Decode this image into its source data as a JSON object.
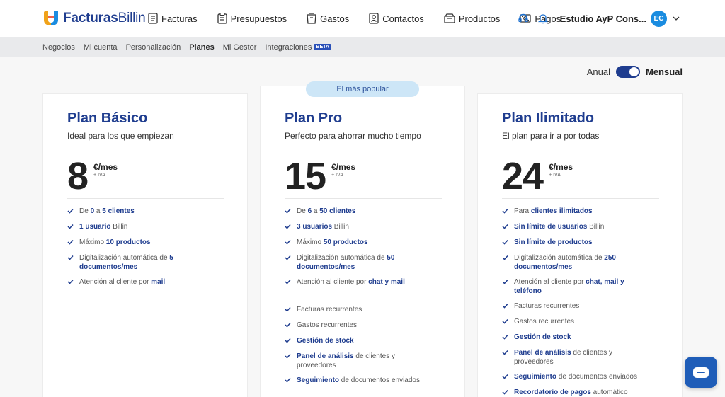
{
  "header": {
    "logo_word1": "Facturas",
    "logo_word2": "Billin",
    "nav": [
      {
        "label": "Facturas",
        "icon": "invoice-icon"
      },
      {
        "label": "Presupuestos",
        "icon": "quote-icon"
      },
      {
        "label": "Gastos",
        "icon": "expenses-icon"
      },
      {
        "label": "Contactos",
        "icon": "contacts-icon"
      },
      {
        "label": "Productos",
        "icon": "products-icon"
      },
      {
        "label": "Pagos",
        "icon": "payments-icon"
      }
    ],
    "account_name": "Estudio AyP Cons...",
    "avatar_initials": "EC"
  },
  "subnav": {
    "items": [
      "Negocios",
      "Mi cuenta",
      "Personalización",
      "Planes",
      "Mi Gestor",
      "Integraciones"
    ],
    "active": "Planes",
    "beta_badge": "BETA"
  },
  "billing_toggle": {
    "left_label": "Anual",
    "right_label": "Mensual",
    "selected": "Mensual"
  },
  "popular_badge": "El más popular",
  "plans": [
    {
      "name": "Plan Básico",
      "description": "Ideal para los que empiezan",
      "price": "8",
      "unit": "€/mes",
      "tax": "+ IVA",
      "features": [
        [
          [
            "De ",
            false
          ],
          [
            "0",
            true
          ],
          [
            " a ",
            false
          ],
          [
            "5 clientes",
            true
          ]
        ],
        [
          [
            "1 usuario",
            true
          ],
          [
            " Billin",
            false
          ]
        ],
        [
          [
            "Máximo ",
            false
          ],
          [
            "10 productos",
            true
          ]
        ],
        [
          [
            "Digitalización automática de ",
            false
          ],
          [
            "5 documentos/mes",
            true
          ]
        ],
        [
          [
            "Atención al cliente por ",
            false
          ],
          [
            "mail",
            true
          ]
        ]
      ],
      "extras": []
    },
    {
      "name": "Plan Pro",
      "description": "Perfecto para ahorrar mucho tiempo",
      "price": "15",
      "unit": "€/mes",
      "tax": "+ IVA",
      "features": [
        [
          [
            "De ",
            false
          ],
          [
            "6",
            true
          ],
          [
            " a ",
            false
          ],
          [
            "50 clientes",
            true
          ]
        ],
        [
          [
            "3 usuarios",
            true
          ],
          [
            " Billin",
            false
          ]
        ],
        [
          [
            "Máximo ",
            false
          ],
          [
            "50 productos",
            true
          ]
        ],
        [
          [
            "Digitalización automática de ",
            false
          ],
          [
            "50 documentos/mes",
            true
          ]
        ],
        [
          [
            "Atención al cliente por ",
            false
          ],
          [
            "chat y mail",
            true
          ]
        ]
      ],
      "extras": [
        [
          [
            "Facturas recurrentes",
            false
          ]
        ],
        [
          [
            "Gastos recurrentes",
            false
          ]
        ],
        [
          [
            "Gestión de stock",
            true
          ]
        ],
        [
          [
            "Panel de análisis",
            true
          ],
          [
            " de clientes y proveedores",
            false
          ]
        ],
        [
          [
            "Seguimiento",
            true
          ],
          [
            " de documentos enviados",
            false
          ]
        ]
      ]
    },
    {
      "name": "Plan Ilimitado",
      "description": "El plan para ir a por todas",
      "price": "24",
      "unit": "€/mes",
      "tax": "+ IVA",
      "features": [
        [
          [
            "Para ",
            false
          ],
          [
            "clientes ilimitados",
            true
          ]
        ],
        [
          [
            "Sin límite de usuarios",
            true
          ],
          [
            " Billin",
            false
          ]
        ],
        [
          [
            "Sin límite de productos",
            true
          ]
        ],
        [
          [
            "Digitalización automática de ",
            false
          ],
          [
            "250 documentos/mes",
            true
          ]
        ],
        [
          [
            "Atención al cliente por ",
            false
          ],
          [
            "chat, mail y teléfono",
            true
          ]
        ],
        [
          [
            "Facturas recurrentes",
            false
          ]
        ],
        [
          [
            "Gastos recurrentes",
            false
          ]
        ],
        [
          [
            "Gestión de stock",
            true
          ]
        ],
        [
          [
            "Panel de análisis",
            true
          ],
          [
            " de clientes y proveedores",
            false
          ]
        ],
        [
          [
            "Seguimiento",
            true
          ],
          [
            " de documentos enviados",
            false
          ]
        ],
        [
          [
            "Recordatorio de pagos",
            true
          ],
          [
            " automático",
            false
          ]
        ]
      ],
      "extras": []
    }
  ],
  "colors": {
    "brand": "#1f3d8f",
    "accent": "#1a8ce0",
    "badge_bg": "#cde6f7"
  }
}
